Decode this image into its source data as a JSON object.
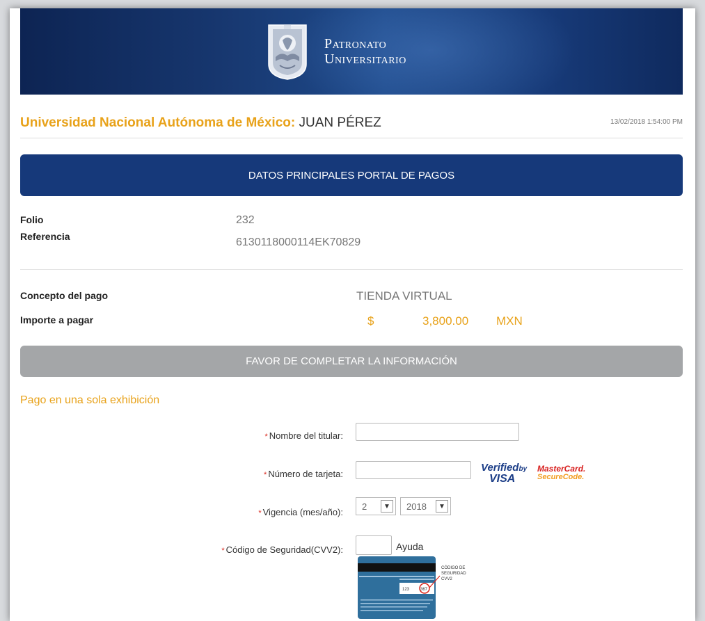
{
  "header": {
    "banner_line1": "Patronato",
    "banner_line2": "Universitario",
    "university": "Universidad Nacional Autónoma de México:",
    "user": "JUAN PÉREZ",
    "timestamp": "13/02/2018 1:54:00 PM"
  },
  "main_section": {
    "title": "DATOS PRINCIPALES PORTAL DE PAGOS",
    "folio_label": "Folio",
    "folio_value": "232",
    "referencia_label": "Referencia",
    "referencia_value": "6130118000114EK70829",
    "concepto_label": "Concepto del pago",
    "concepto_value": "TIENDA VIRTUAL",
    "importe_label": "Importe a pagar",
    "currency_symbol": "$",
    "importe_value": "3,800.00",
    "currency_code": "MXN"
  },
  "form": {
    "title": "FAVOR DE COMPLETAR LA INFORMACIÓN",
    "subtitle": "Pago en una sola exhibición",
    "required_mark": "*",
    "nombre_label": "Nombre del titular:",
    "nombre_value": "",
    "tarjeta_label": "Número de tarjeta:",
    "tarjeta_value": "",
    "vigencia_label": "Vigencia (mes/año):",
    "mes_value": "2",
    "anio_value": "2018",
    "cvv_label": "Código de Seguridad(CVV2):",
    "cvv_value": "",
    "ayuda_label": "Ayuda"
  },
  "logos": {
    "visa_line1": "Verified",
    "visa_by": "by",
    "visa_line2": "VISA",
    "mastercard_line1": "MasterCard.",
    "mastercard_line2": "SecureCode."
  },
  "cvv_help": {
    "cvv_digits": "367",
    "label_line1": "CÓDIGO DE",
    "label_line2": "SEGURIDAD",
    "label_line3": "CVV2"
  },
  "colors": {
    "banner": "#16397a",
    "accent": "#e8a21a",
    "grey_bar": "#a4a6a8",
    "required": "#d9261c"
  }
}
